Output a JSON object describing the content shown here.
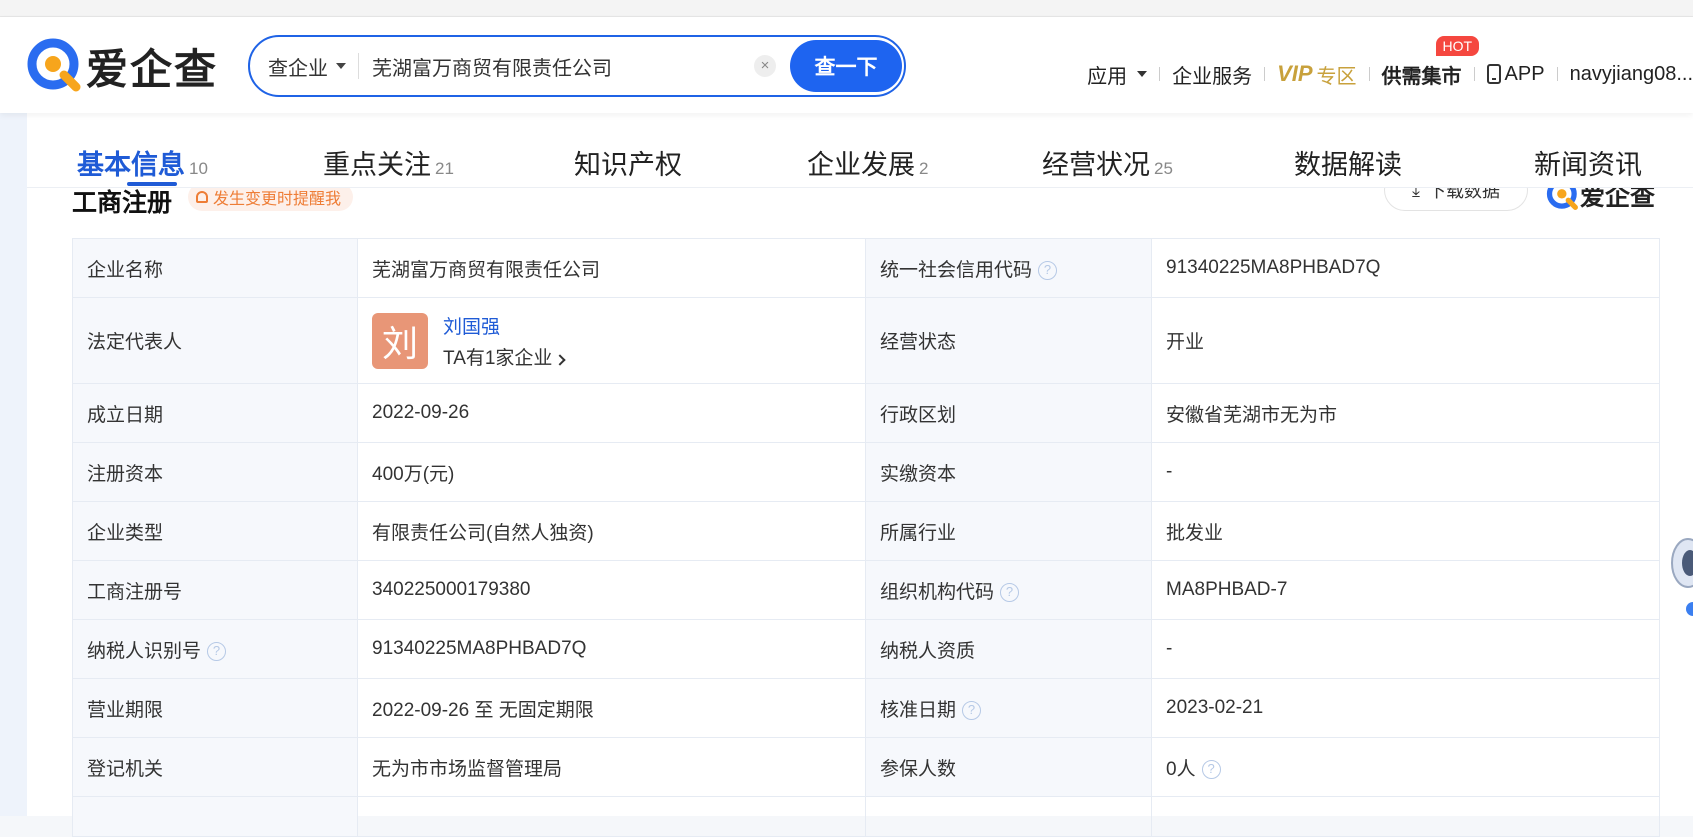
{
  "header": {
    "logo_text": "爱企查",
    "search": {
      "type_label": "查企业",
      "value": "芜湖富万商贸有限责任公司",
      "button_label": "查一下",
      "clear_icon": "close-icon"
    },
    "nav": {
      "apps": "应用",
      "enterprise_service": "企业服务",
      "vip": "VIP",
      "vip_zone": "专区",
      "supply": "供需集市",
      "hot": "HOT",
      "app": "APP",
      "user": "navyjiang08..."
    }
  },
  "tabs": [
    {
      "label": "基本信息",
      "count": "10"
    },
    {
      "label": "重点关注",
      "count": "21"
    },
    {
      "label": "知识产权",
      "count": ""
    },
    {
      "label": "企业发展",
      "count": "2"
    },
    {
      "label": "经营状况",
      "count": "25"
    },
    {
      "label": "数据解读",
      "count": ""
    },
    {
      "label": "新闻资讯",
      "count": ""
    }
  ],
  "section": {
    "title": "工商注册",
    "remind": "发生变更时提醒我",
    "download": "下载数据",
    "logo_text": "爱企查"
  },
  "table": {
    "rows": [
      {
        "l1": "企业名称",
        "v1": "芜湖富万商贸有限责任公司",
        "l2": "统一社会信用代码",
        "v2": "91340225MA8PHBAD7Q"
      },
      {
        "l1": "法定代表人",
        "l2": "经营状态",
        "v2": "开业"
      },
      {
        "l1": "成立日期",
        "v1": "2022-09-26",
        "l2": "行政区划",
        "v2": "安徽省芜湖市无为市"
      },
      {
        "l1": "注册资本",
        "v1": "400万(元)",
        "l2": "实缴资本",
        "v2": "-"
      },
      {
        "l1": "企业类型",
        "v1": "有限责任公司(自然人独资)",
        "l2": "所属行业",
        "v2": "批发业"
      },
      {
        "l1": "工商注册号",
        "v1": "340225000179380",
        "l2": "组织机构代码",
        "v2": "MA8PHBAD-7"
      },
      {
        "l1": "纳税人识别号",
        "v1": "91340225MA8PHBAD7Q",
        "l2": "纳税人资质",
        "v2": "-"
      },
      {
        "l1": "营业期限",
        "v1": "2022-09-26 至 无固定期限",
        "l2": "核准日期",
        "v2": "2023-02-21"
      },
      {
        "l1": "登记机关",
        "v1": "无为市市场监督管理局",
        "l2": "参保人数",
        "v2": "0人"
      }
    ],
    "legal_rep": {
      "avatar_char": "刘",
      "name": "刘国强",
      "sub": "TA有1家企业"
    },
    "help_mark": "?"
  }
}
